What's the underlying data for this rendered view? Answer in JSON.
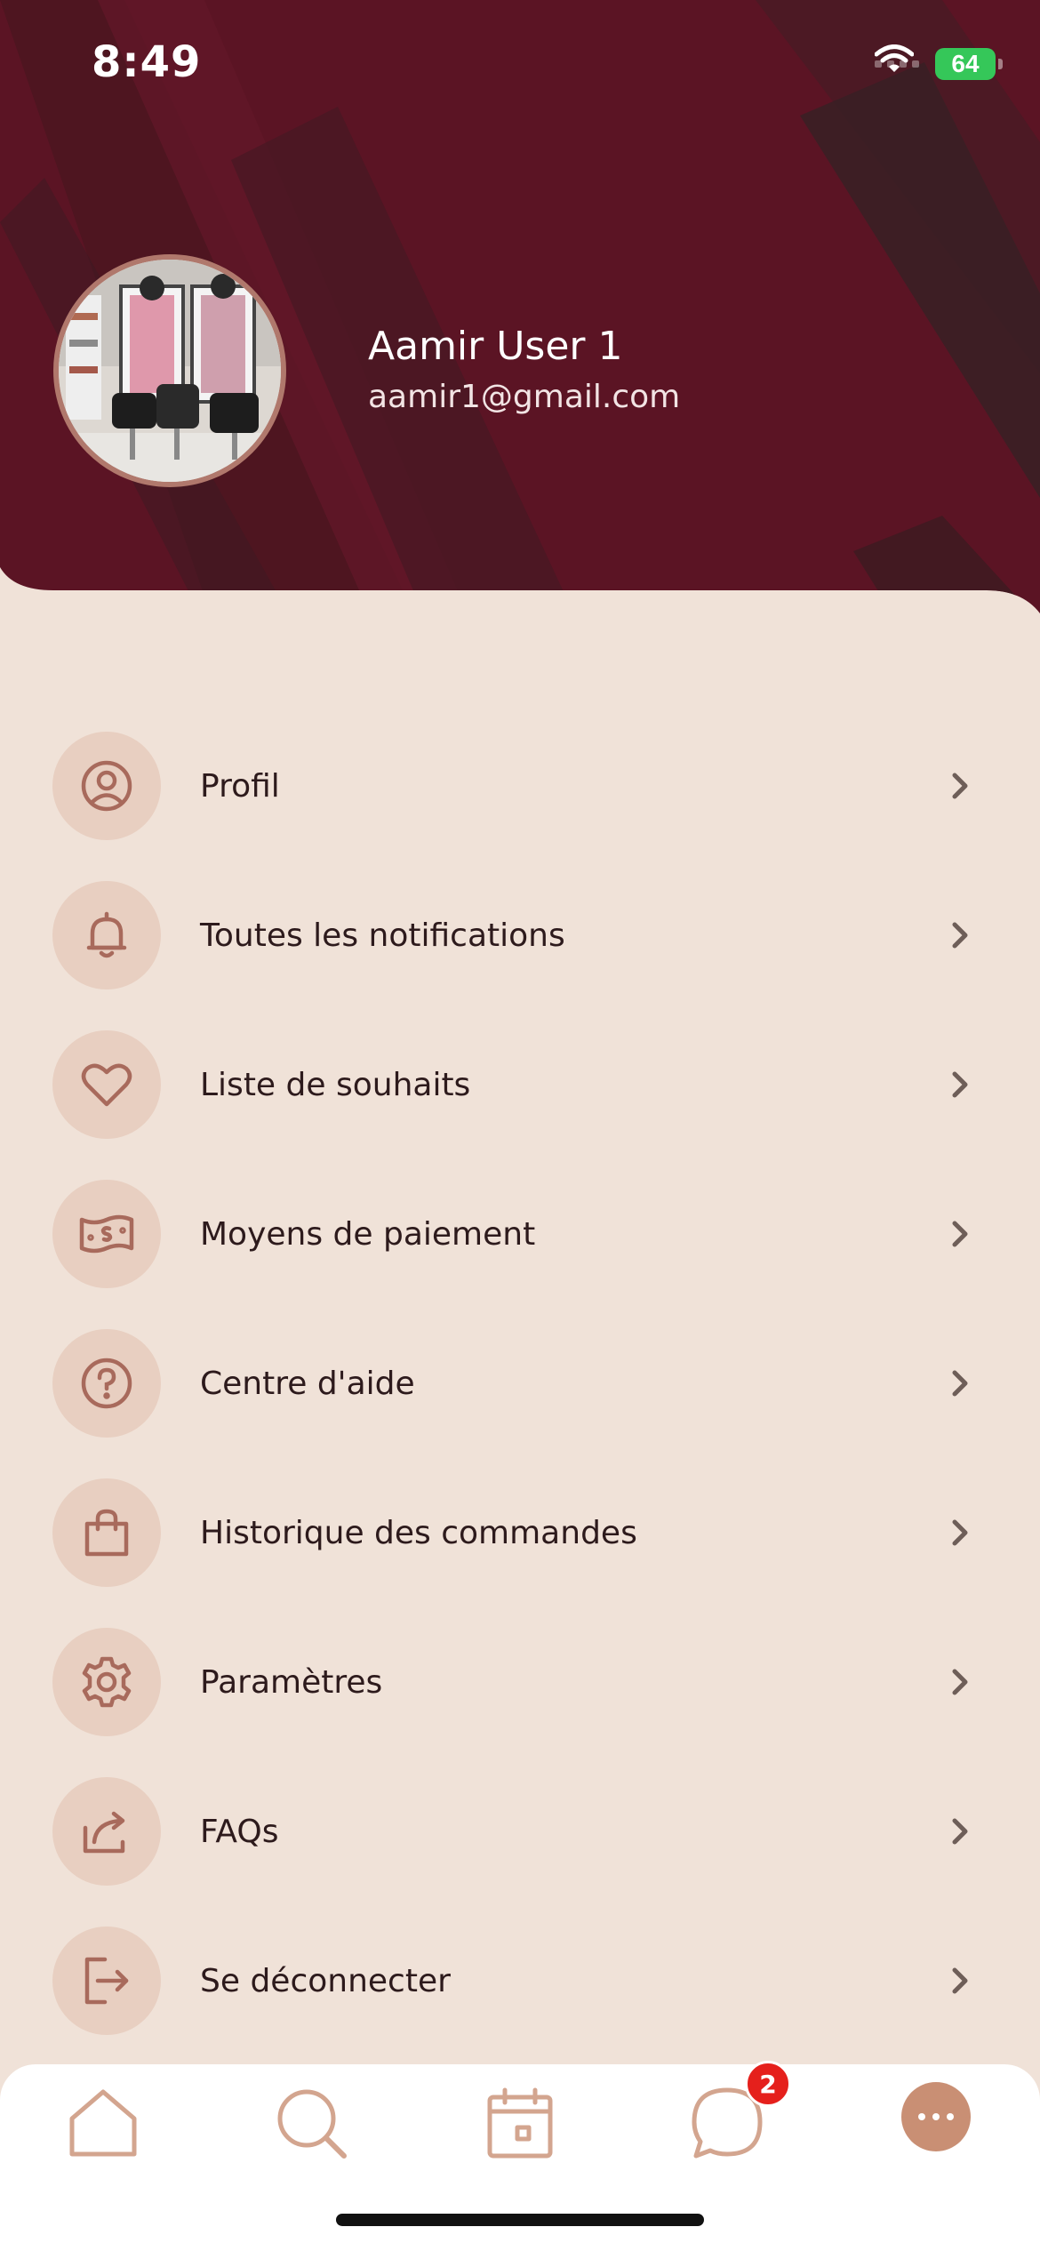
{
  "status_bar": {
    "time": "8:49",
    "battery": "64"
  },
  "profile": {
    "name": "Aamir User 1",
    "email": "aamir1@gmail.com"
  },
  "menu": [
    {
      "label": "Profil",
      "icon": "user-circle-icon"
    },
    {
      "label": "Toutes les notifications",
      "icon": "bell-icon"
    },
    {
      "label": "Liste de souhaits",
      "icon": "heart-icon"
    },
    {
      "label": "Moyens de paiement",
      "icon": "banknote-icon"
    },
    {
      "label": "Centre d'aide",
      "icon": "question-circle-icon"
    },
    {
      "label": "Historique des commandes",
      "icon": "shopping-bag-icon"
    },
    {
      "label": "Paramètres",
      "icon": "gear-icon"
    },
    {
      "label": "FAQs",
      "icon": "share-arrow-icon"
    },
    {
      "label": "Se déconnecter",
      "icon": "logout-icon"
    }
  ],
  "tabs": {
    "items": [
      "home-icon",
      "search-icon",
      "calendar-icon",
      "chat-icon",
      "more-icon"
    ],
    "chat_badge": "2"
  },
  "colors": {
    "header_bg": "#5b1424",
    "page_bg": "#f0e2d8",
    "icon_bg": "#e8cfc1",
    "icon_stroke": "#a86a5c",
    "accent": "#c98f74",
    "badge": "#e5201c"
  }
}
